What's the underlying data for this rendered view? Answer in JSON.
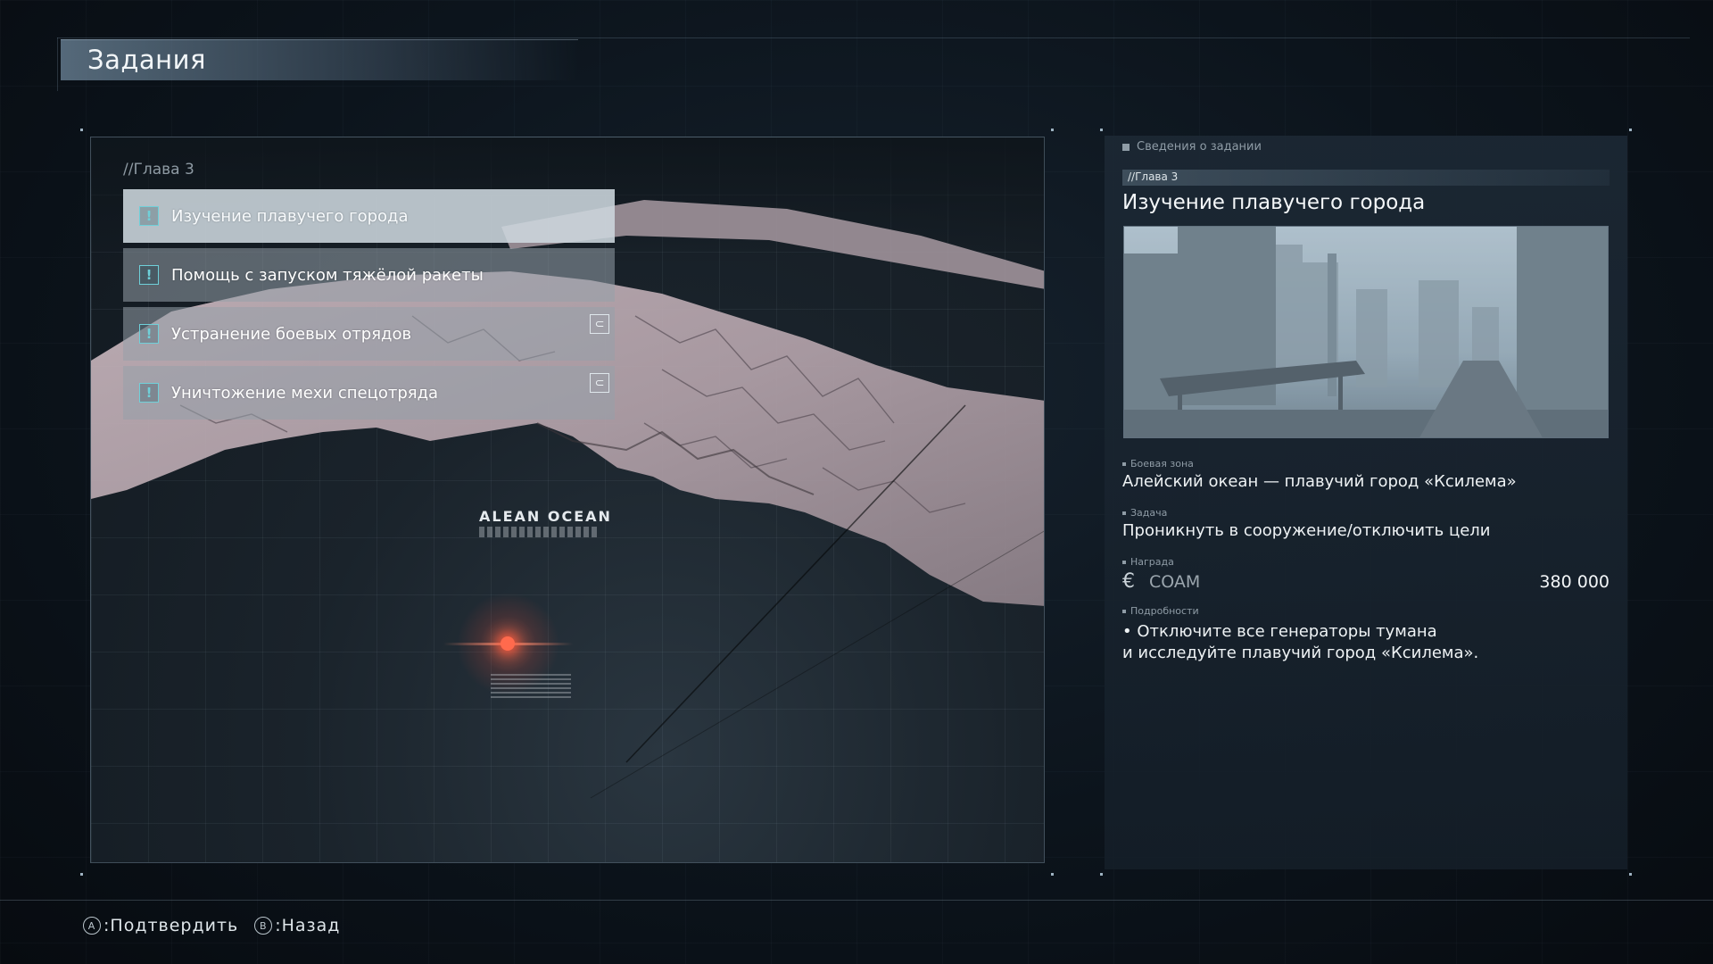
{
  "header": {
    "title": "Задания"
  },
  "map": {
    "chapter": "//Глава 3",
    "ocean_label": "ALEAN OCEAN",
    "missions": [
      {
        "label": "Изучение плавучего города",
        "icon": "exclamation-icon",
        "selected": true,
        "tag": false
      },
      {
        "label": "Помощь с запуском тяжёлой ракеты",
        "icon": "exclamation-icon",
        "selected": false,
        "tag": false
      },
      {
        "label": "Устранение боевых отрядов",
        "icon": "exclamation-icon",
        "selected": false,
        "tag": true
      },
      {
        "label": "Уничтожение мехи спецотряда",
        "icon": "exclamation-icon",
        "selected": false,
        "tag": true
      }
    ],
    "tag_glyph": "⊂"
  },
  "details": {
    "section_title": "Сведения о задании",
    "chapter": "//Глава 3",
    "title": "Изучение плавучего города",
    "combat_zone_label": "Боевая зона",
    "combat_zone": "Алейский океан — плавучий город «Ксилема»",
    "objective_label": "Задача",
    "objective": "Проникнуть в сооружение/отключить цели",
    "reward_label": "Награда",
    "reward_currency_icon": "€",
    "reward_currency": "COAM",
    "reward_amount": "380 000",
    "details_label": "Подробности",
    "details_line1": "• Отключите все генераторы тумана",
    "details_line2": "и исследуйте плавучий город «Ксилема»."
  },
  "footer": {
    "confirm_glyph": "A",
    "confirm_label": ":Подтвердить",
    "back_glyph": "B",
    "back_label": ":Назад"
  },
  "colors": {
    "accent": "#6fd0d9",
    "marker": "#ff6a4d"
  }
}
